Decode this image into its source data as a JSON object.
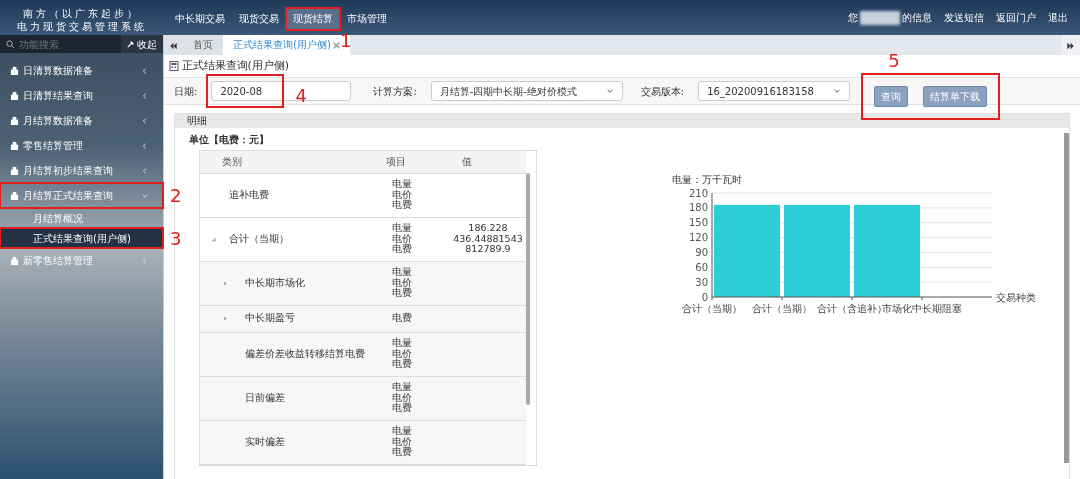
{
  "app": {
    "title_line_1": "南方（以广东起步）",
    "title_line_2": "电力现货交易管理系统"
  },
  "top_nav": [
    {
      "label": "中长期交易",
      "selected": false
    },
    {
      "label": "现货交易",
      "selected": false
    },
    {
      "label": "现货结算",
      "selected": true,
      "annotation": "1"
    },
    {
      "label": "市场管理",
      "selected": false
    }
  ],
  "user_links": [
    "您",
    "的信息",
    "发送短信",
    "返回门户",
    "退出"
  ],
  "sidebar": {
    "search_placeholder": "功能搜索",
    "collapse_label": "收起",
    "items": [
      {
        "label": "日清算数据准备",
        "expanded": false
      },
      {
        "label": "日清算结果查询",
        "expanded": false
      },
      {
        "label": "月结算数据准备",
        "expanded": false
      },
      {
        "label": "零售结算管理",
        "expanded": false
      },
      {
        "label": "月结算初步结果查询",
        "expanded": false
      },
      {
        "label": "月结算正式结果查询",
        "expanded": true,
        "annotation": "2",
        "children": [
          {
            "label": "月结算概况",
            "selected": false
          },
          {
            "label": "正式结果查询(用户侧)",
            "selected": true,
            "annotation": "3"
          }
        ]
      },
      {
        "label": "新零售结算管理",
        "expanded": false
      }
    ]
  },
  "tabs": [
    {
      "label": "首页",
      "selected": false,
      "closable": false
    },
    {
      "label": "正式结果查询(用户侧)",
      "selected": true,
      "closable": true
    }
  ],
  "page_title": "正式结果查询(用户侧)",
  "filters": {
    "date_label": "日期:",
    "date_value": "2020-08",
    "date_annotation": "4",
    "scheme_label": "计算方案:",
    "scheme_value": "月结算-四期中长期-绝对价模式",
    "version_label": "交易版本:",
    "version_value": "16_20200916183158",
    "buttons": [
      "查询",
      "结算单下载"
    ],
    "buttons_annotation": "5"
  },
  "panel_title": "明细",
  "unit": "单位【电费：元】",
  "table": {
    "columns": [
      "类别",
      "项目",
      "值"
    ],
    "rows": [
      {
        "category": "追补电费",
        "items": [
          "电量",
          "电价",
          "电费"
        ]
      },
      {
        "category": "合计（当期）",
        "expanded": true,
        "items": [
          "电量",
          "电价",
          "电费"
        ],
        "values": [
          "186.228",
          "436.44881543",
          "812789.9"
        ],
        "children": [
          {
            "category": "中长期市场化",
            "expanded": false,
            "items": [
              "电量",
              "电价",
              "电费"
            ]
          },
          {
            "category": "中长期盈亏",
            "expanded": false,
            "items": [
              "电费"
            ]
          },
          {
            "category": "偏差价差收益转移结算电费",
            "items": [
              "电量",
              "电价",
              "电费"
            ]
          },
          {
            "category": "日前偏差",
            "items": [
              "电量",
              "电价",
              "电费"
            ]
          },
          {
            "category": "实时偏差",
            "items": [
              "电量",
              "电价",
              "电费"
            ]
          }
        ]
      }
    ]
  },
  "chart_data": {
    "type": "bar",
    "ylabel": "电量：万千瓦时",
    "xlabel": "交易种类",
    "grid": true,
    "categories": [
      "合计（当期）",
      "合计（当期）",
      "合计（含追补）",
      "市场化中长期阻塞"
    ],
    "series": [
      {
        "color": "#2ccfd6",
        "values": [
          186,
          186,
          186,
          null
        ]
      }
    ],
    "ylim": [
      0,
      210
    ],
    "yticks": [
      0,
      30,
      60,
      90,
      120,
      150,
      180,
      210
    ]
  }
}
